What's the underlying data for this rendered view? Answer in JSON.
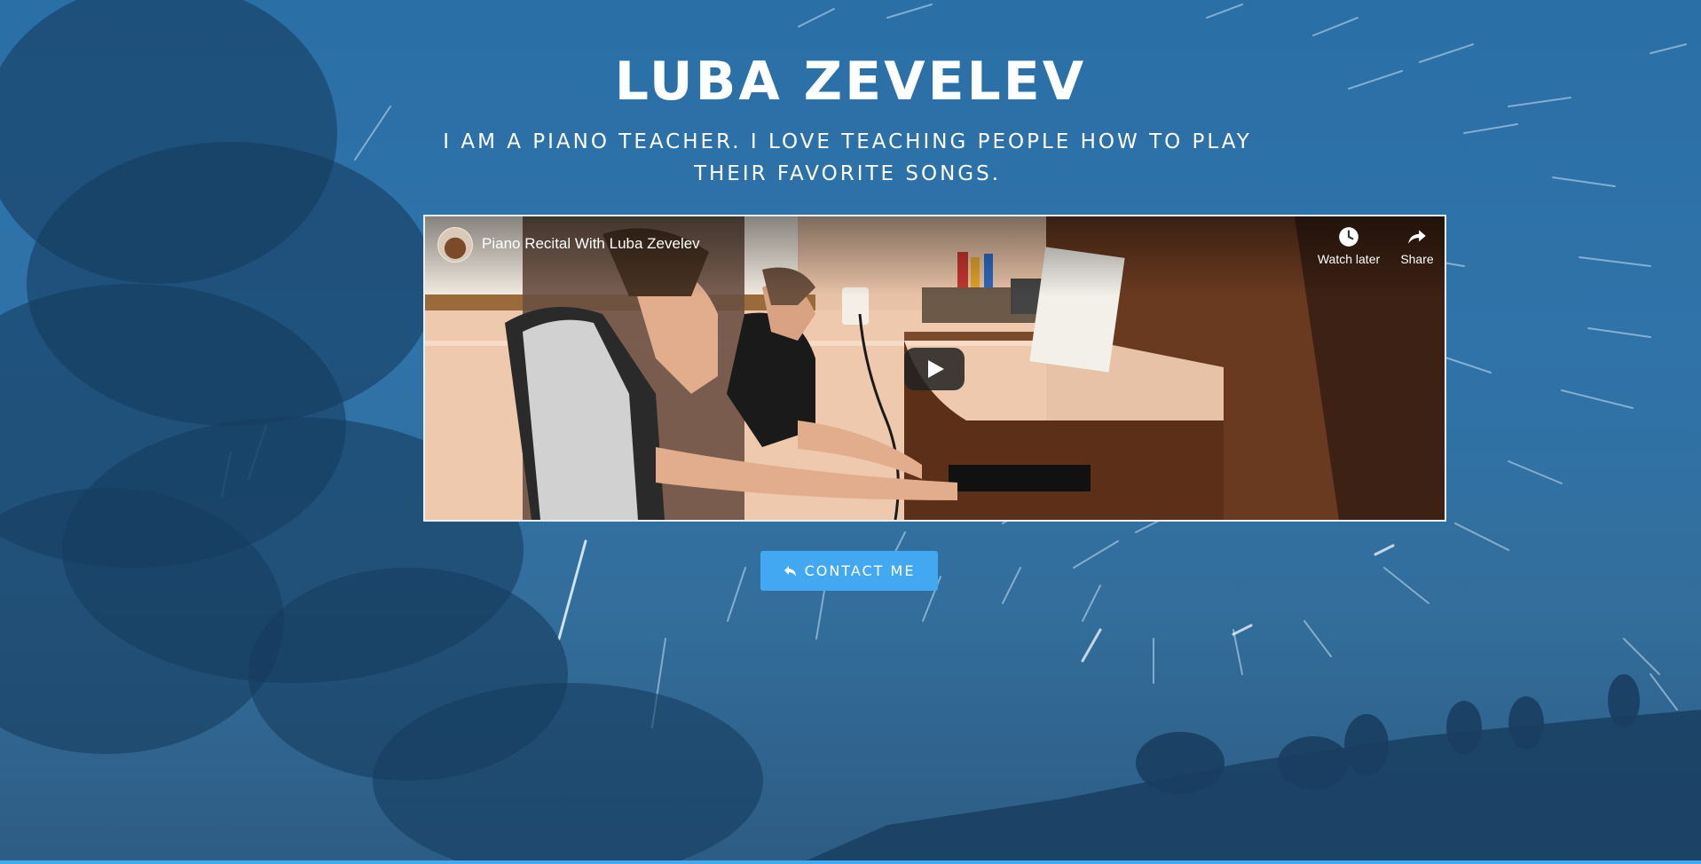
{
  "hero": {
    "name": "LUBA ZEVELEV",
    "tagline": "I am a piano teacher. I love teaching people how to play their favorite songs."
  },
  "video": {
    "title": "Piano Recital With Luba Zevelev",
    "watch_later_label": "Watch later",
    "share_label": "Share"
  },
  "contact": {
    "label": "CONTACT ME"
  },
  "icons": {
    "contact": "reply-icon",
    "watch_later": "clock-icon",
    "share": "share-icon",
    "play": "play-icon"
  },
  "colors": {
    "accent": "#42a8f1",
    "background": "#2f73a9"
  }
}
